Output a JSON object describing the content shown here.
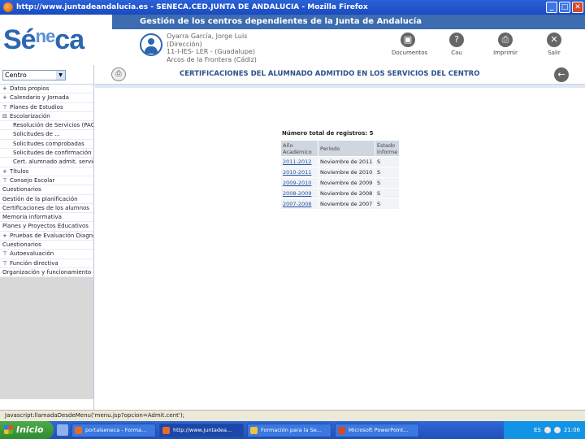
{
  "window": {
    "title": "http://www.juntadeandalucia.es - SENECA.CED.JUNTA DE ANDALUCIA - Mozilla Firefox",
    "btn_min": "_",
    "btn_max": "□",
    "btn_close": "✕"
  },
  "header": {
    "logo_main": "Sé",
    "logo_sup": "ne",
    "logo_end": "ca",
    "band_title": "Gestión de los centros dependientes de la Junta de Andalucía",
    "user_lines": [
      "Oyarra García, Jorge Luis",
      "(Dirección)",
      "11-I-IES- LER - (Guadalupe)",
      "Arcos de la Frontera (Cádiz)"
    ],
    "tools": [
      {
        "icon": "document-icon",
        "glyph": "▣",
        "label": "Documentos"
      },
      {
        "icon": "help-icon",
        "glyph": "?",
        "label": "Cau"
      },
      {
        "icon": "print-icon",
        "glyph": "⎙",
        "label": "Imprimir"
      },
      {
        "icon": "exit-icon",
        "glyph": "✕",
        "label": "Salir"
      }
    ]
  },
  "sidebar": {
    "centro_label": "Centro",
    "menu": [
      {
        "pfx": "+",
        "label": "Datos propios",
        "level": 0
      },
      {
        "pfx": "+",
        "label": "Calendario y Jornada",
        "level": 0
      },
      {
        "pfx": "⊤",
        "label": "Planes de Estudios",
        "level": 0
      },
      {
        "pfx": "⊟",
        "label": "Escolarización",
        "level": 0
      },
      {
        "pfx": "",
        "label": "Resolución de Servicios (PAC",
        "level": 1
      },
      {
        "pfx": "",
        "label": "Solicitudes de ... ",
        "level": 1
      },
      {
        "pfx": "",
        "label": "Solicitudes comprobadas",
        "level": 1
      },
      {
        "pfx": "",
        "label": "Solicitudes de confirmación y/ne",
        "level": 1
      },
      {
        "pfx": "",
        "label": "Cert. alumnado admit. servic. cent",
        "level": 1
      },
      {
        "pfx": "+",
        "label": "Títulos",
        "level": 0
      },
      {
        "pfx": "⊤",
        "label": "Consejo Escolar",
        "level": 0
      },
      {
        "pfx": "",
        "label": "Cuestionarios",
        "level": 0
      },
      {
        "pfx": "",
        "label": "Gestión de la planificación",
        "level": 0
      },
      {
        "pfx": "",
        "label": "Certificaciones de los alumnos",
        "level": 0
      },
      {
        "pfx": "",
        "label": "Memoria informativa",
        "level": 0
      },
      {
        "pfx": "",
        "label": "Planes y Proyectos Educativos",
        "level": 0
      },
      {
        "pfx": "+",
        "label": "Pruebas de Evaluación Diagnóstica",
        "level": 0
      },
      {
        "pfx": "",
        "label": "Cuestionarios",
        "level": 0
      },
      {
        "pfx": "⊤",
        "label": "Autoevaluación",
        "level": 0
      },
      {
        "pfx": "⊤",
        "label": "Función directiva",
        "level": 0
      },
      {
        "pfx": "",
        "label": "Organización y funcionamiento de Ed",
        "level": 0
      }
    ]
  },
  "main": {
    "print_glyph": "⎙",
    "back_glyph": "←",
    "title": "CERTIFICACIONES DEL ALUMNADO ADMITIDO EN LOS SERVICIOS DEL CENTRO",
    "count_label": "Número total de registros: 5",
    "table": {
      "headers": [
        "Año Académico",
        "Período",
        "Estado Informe"
      ],
      "rows": [
        [
          "2011-2012",
          "Noviembre de 2011",
          "S"
        ],
        [
          "2010-2011",
          "Noviembre de 2010",
          "S"
        ],
        [
          "2009-2010",
          "Noviembre de 2009",
          "S"
        ],
        [
          "2008-2009",
          "Noviembre de 2008",
          "S"
        ],
        [
          "2007-2008",
          "Noviembre de 2007",
          "S"
        ]
      ]
    }
  },
  "statusbar": {
    "text": "Javascript:llamadaDesdeMenu('menu.jsp?opcion=Admit.cent');"
  },
  "taskbar": {
    "start_label": "Inicio",
    "tasks": [
      {
        "label": "portalseneca - Forma...",
        "color": "#e56b2a"
      },
      {
        "label": "http://www.juntadea...",
        "color": "#e56b2a"
      },
      {
        "label": "Formación para la Se...",
        "color": "#f0c040"
      },
      {
        "label": "Microsoft PowerPoint...",
        "color": "#d24a2a"
      }
    ],
    "lang": "ES",
    "clock": "21:06"
  },
  "colors": {
    "brand_blue": "#3d6cb0",
    "title_blue": "#2c4f8a",
    "link_blue": "#2255aa"
  }
}
